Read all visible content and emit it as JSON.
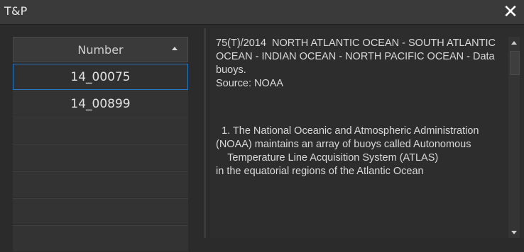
{
  "window": {
    "title": "T&P",
    "close_glyph": "✕"
  },
  "list": {
    "column_header": "Number",
    "sort_direction": "ascending",
    "rows": [
      "14_00075",
      "14_00899"
    ],
    "selected_index": 0
  },
  "detail": {
    "paragraphs": [
      "75(T)/2014  NORTH ATLANTIC OCEAN - SOUTH ATLANTIC OCEAN - INDIAN OCEAN - NORTH PACIFIC OCEAN - Data\nbuoys.\nSource: NOAA",
      "  1. The National Oceanic and Atmospheric Administration (NOAA) maintains an array of buoys called Autonomous\n    Temperature Line Acquisition System (ATLAS)\nin the equatorial regions of the Atlantic Ocean"
    ]
  },
  "colors": {
    "selection_border": "#2a78c4",
    "background": "#2b2b2b"
  },
  "icons": {
    "close": "close-icon",
    "sort": "sort-ascending-icon",
    "scroll_up": "scroll-up-icon",
    "scroll_down": "scroll-down-icon"
  }
}
